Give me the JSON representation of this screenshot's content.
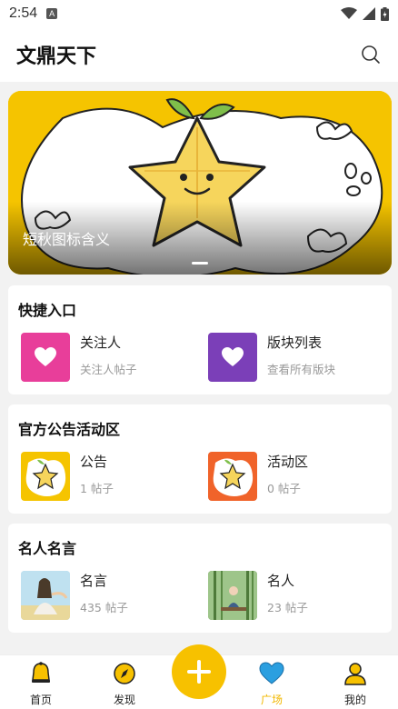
{
  "status": {
    "time": "2:54",
    "notification_glyph": "A"
  },
  "app": {
    "title": "文鼎天下"
  },
  "banner": {
    "caption": "短秋图标含义"
  },
  "sections": [
    {
      "title": "快捷入口",
      "items": [
        {
          "name": "关注人",
          "sub": "关注人帖子",
          "icon": "heart-icon",
          "color": "#e83e9a"
        },
        {
          "name": "版块列表",
          "sub": "查看所有版块",
          "icon": "heart-icon",
          "color": "#7b3fb8"
        }
      ]
    },
    {
      "title": "官方公告活动区",
      "items": [
        {
          "name": "公告",
          "sub": "1 帖子",
          "icon": "starfruit-thumbnail",
          "color": "#f5c400"
        },
        {
          "name": "活动区",
          "sub": "0 帖子",
          "icon": "starfruit-thumbnail",
          "color": "#f0632a"
        }
      ]
    },
    {
      "title": "名人名言",
      "items": [
        {
          "name": "名言",
          "sub": "435 帖子",
          "icon": "fairy-painting-thumbnail",
          "color": "#a9d4ea"
        },
        {
          "name": "名人",
          "sub": "23 帖子",
          "icon": "bamboo-painting-thumbnail",
          "color": "#6f9a5a"
        }
      ]
    }
  ],
  "tabs": [
    {
      "label": "首页",
      "icon": "bell-icon"
    },
    {
      "label": "发现",
      "icon": "compass-icon"
    },
    {
      "label": "广场",
      "icon": "heart-icon",
      "active": true
    },
    {
      "label": "我的",
      "icon": "user-icon"
    }
  ],
  "colors": {
    "accent": "#f7c100",
    "active_tab": "#f2b800"
  }
}
